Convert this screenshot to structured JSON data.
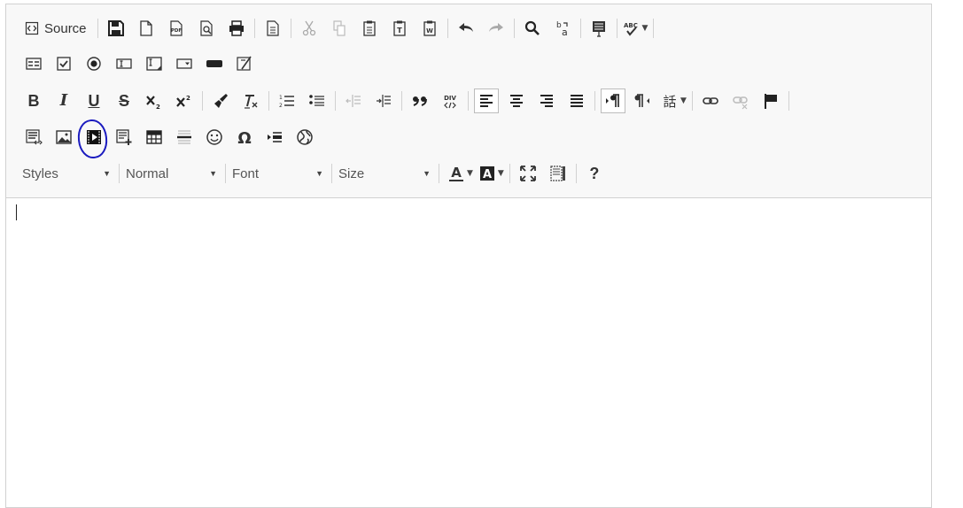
{
  "toolbar": {
    "source_label": "Source",
    "styles_combo": "Styles",
    "format_combo": "Normal",
    "font_combo": "Font",
    "size_combo": "Size",
    "help_label": "?"
  },
  "colors": {
    "highlight_circle": "#1b1bbf",
    "border": "#d1d1d1",
    "toolbar_bg": "#f8f8f8"
  },
  "editor": {
    "content": ""
  }
}
